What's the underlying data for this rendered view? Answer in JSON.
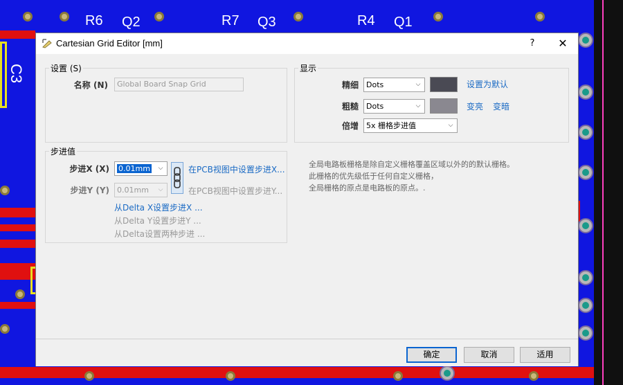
{
  "pcb": {
    "labels": [
      "R6",
      "Q2",
      "R7",
      "Q3",
      "R4",
      "Q1"
    ],
    "side_label": "C3",
    "colors": {
      "board": "#1016e0",
      "trace": "#e01010",
      "silk": "#e8e020",
      "edge": "#ff40c0"
    }
  },
  "dialog": {
    "title": "Cartesian Grid Editor [mm]",
    "help_label": "?",
    "close_label": "✕",
    "settings": {
      "group_title": "设置 (S)",
      "name_label": "名称 (N)",
      "name_value": "Global Board Snap Grid"
    },
    "display": {
      "group_title": "显示",
      "fine_label": "精细",
      "fine_value": "Dots",
      "fine_color": "#4a4a54",
      "coarse_label": "粗糙",
      "coarse_value": "Dots",
      "coarse_color": "#8a8890",
      "multiplier_label": "倍增",
      "multiplier_value": "5x 栅格步进值",
      "set_default_link": "设置为默认",
      "lighten_link": "变亮",
      "darken_link": "变暗"
    },
    "step": {
      "group_title": "步进值",
      "step_x_label": "步进X (X)",
      "step_x_value": "0.01mm",
      "step_y_label": "步进Y (Y)",
      "step_y_value": "0.01mm",
      "set_x_in_pcb": "在PCB视图中设置步进X...",
      "set_y_in_pcb": "在PCB视图中设置步进Y...",
      "from_delta_x": "从Delta X设置步进X ...",
      "from_delta_y": "从Delta Y设置步进Y ...",
      "from_delta_both": "从Delta设置两种步进 ..."
    },
    "info_lines": [
      "全局电路板栅格是除自定义栅格覆盖区域以外的的默认栅格。",
      "此栅格的优先级低于任何自定义栅格，",
      "全局栅格的原点是电路板的原点。."
    ],
    "buttons": {
      "ok": "确定",
      "cancel": "取消",
      "apply": "适用"
    }
  }
}
